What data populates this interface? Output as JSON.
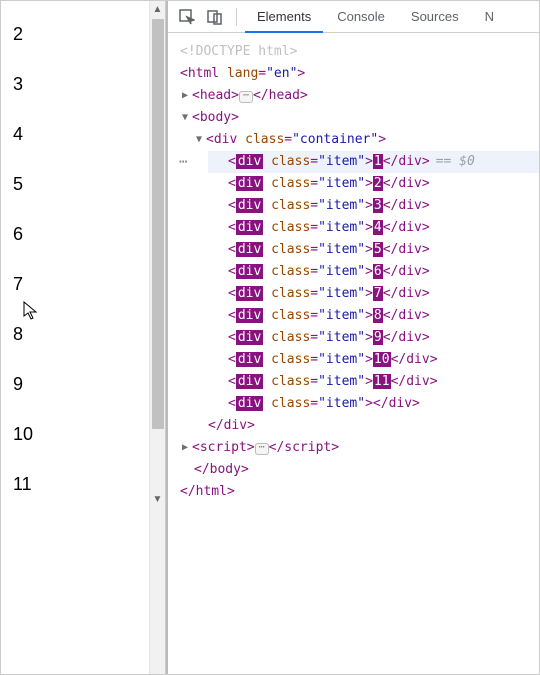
{
  "page": {
    "numbers": [
      "2",
      "3",
      "4",
      "5",
      "6",
      "7",
      "8",
      "9",
      "10",
      "11"
    ]
  },
  "toolbar": {
    "tabs": [
      "Elements",
      "Console",
      "Sources",
      "N"
    ],
    "active_tab": "Elements"
  },
  "dom": {
    "doctype": "<!DOCTYPE html>",
    "html_open": {
      "tag": "html",
      "attr": "lang",
      "val": "\"en\""
    },
    "head": {
      "tag": "head"
    },
    "body": {
      "tag": "body"
    },
    "container": {
      "tag": "div",
      "attr": "class",
      "val": "\"container\""
    },
    "item_attr": "class",
    "item_val": "\"item\"",
    "items": [
      "1",
      "2",
      "3",
      "4",
      "5",
      "6",
      "7",
      "8",
      "9",
      "10",
      "11",
      ""
    ],
    "selected_suffix": "== $0",
    "script": {
      "tag": "script"
    },
    "close_div": "div",
    "close_body": "body",
    "close_html": "html"
  }
}
